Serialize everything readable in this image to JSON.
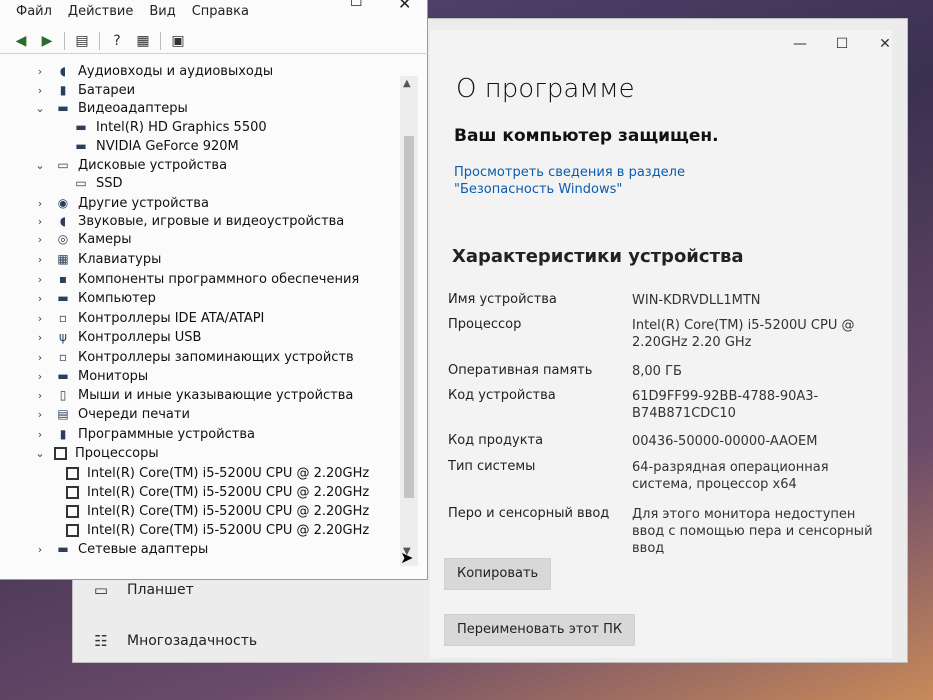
{
  "device_manager": {
    "menu": [
      "Файл",
      "Действие",
      "Вид",
      "Справка"
    ],
    "tree": [
      {
        "label": "Аудиовходы и аудиовыходы",
        "icon": "speaker-icon",
        "level": 0,
        "expanded": false
      },
      {
        "label": "Батареи",
        "icon": "battery-icon",
        "level": 0,
        "expanded": false
      },
      {
        "label": "Видеоадаптеры",
        "icon": "monitor-icon",
        "level": 0,
        "expanded": true
      },
      {
        "label": "Intel(R) HD Graphics 5500",
        "icon": "monitor-icon",
        "level": 1
      },
      {
        "label": "NVIDIA GeForce 920M",
        "icon": "monitor-icon",
        "level": 1
      },
      {
        "label": "Дисковые устройства",
        "icon": "disk-icon",
        "level": 0,
        "expanded": true
      },
      {
        "label": "SSD",
        "icon": "disk-icon",
        "level": 1
      },
      {
        "label": "Другие устройства",
        "icon": "unknown-device-icon",
        "level": 0,
        "expanded": false
      },
      {
        "label": "Звуковые, игровые и видеоустройства",
        "icon": "speaker-icon",
        "level": 0,
        "expanded": false
      },
      {
        "label": "Камеры",
        "icon": "camera-icon",
        "level": 0,
        "expanded": false
      },
      {
        "label": "Клавиатуры",
        "icon": "keyboard-icon",
        "level": 0,
        "expanded": false
      },
      {
        "label": "Компоненты программного обеспечения",
        "icon": "component-icon",
        "level": 0,
        "expanded": false
      },
      {
        "label": "Компьютер",
        "icon": "computer-icon",
        "level": 0,
        "expanded": false
      },
      {
        "label": "Контроллеры IDE ATA/ATAPI",
        "icon": "controller-icon",
        "level": 0,
        "expanded": false
      },
      {
        "label": "Контроллеры USB",
        "icon": "usb-icon",
        "level": 0,
        "expanded": false
      },
      {
        "label": "Контроллеры запоминающих устройств",
        "icon": "storage-controller-icon",
        "level": 0,
        "expanded": false
      },
      {
        "label": "Мониторы",
        "icon": "monitor-icon",
        "level": 0,
        "expanded": false
      },
      {
        "label": "Мыши и иные указывающие устройства",
        "icon": "mouse-icon",
        "level": 0,
        "expanded": false
      },
      {
        "label": "Очереди печати",
        "icon": "printer-icon",
        "level": 0,
        "expanded": false
      },
      {
        "label": "Программные устройства",
        "icon": "software-device-icon",
        "level": 0,
        "expanded": false
      },
      {
        "label": "Процессоры",
        "icon": "cpu-icon",
        "level": 0,
        "expanded": true
      },
      {
        "label": "Intel(R) Core(TM) i5-5200U CPU @ 2.20GHz",
        "icon": "cpu-icon",
        "level": 1
      },
      {
        "label": "Intel(R) Core(TM) i5-5200U CPU @ 2.20GHz",
        "icon": "cpu-icon",
        "level": 1
      },
      {
        "label": "Intel(R) Core(TM) i5-5200U CPU @ 2.20GHz",
        "icon": "cpu-icon",
        "level": 1
      },
      {
        "label": "Intel(R) Core(TM) i5-5200U CPU @ 2.20GHz",
        "icon": "cpu-icon",
        "level": 1
      },
      {
        "label": "Сетевые адаптеры",
        "icon": "network-icon",
        "level": 0,
        "expanded": false
      }
    ]
  },
  "settings": {
    "nav": [
      {
        "label": "Планшет",
        "icon": "tablet-icon"
      },
      {
        "label": "Многозадачность",
        "icon": "multitasking-icon"
      }
    ],
    "about": {
      "title": "О программе",
      "protected": "Ваш компьютер защищен.",
      "security_link": "Просмотреть сведения в разделе \"Безопасность Windows\"",
      "specs_title": "Характеристики устройства",
      "specs": [
        {
          "label": "Имя устройства",
          "value": "WIN-KDRVDLL1MTN"
        },
        {
          "label": "Процессор",
          "value": "Intel(R) Core(TM) i5-5200U CPU @ 2.20GHz   2.20 GHz"
        },
        {
          "label": "Оперативная память",
          "value": "8,00 ГБ"
        },
        {
          "label": "Код устройства",
          "value": "61D9FF99-92BB-4788-90A3-B74B871CDC10"
        },
        {
          "label": "Код продукта",
          "value": "00436-50000-00000-AAOEM"
        },
        {
          "label": "Тип системы",
          "value": "64-разрядная операционная система, процессор x64"
        },
        {
          "label": "Перо и сенсорный ввод",
          "value": "Для этого монитора недоступен ввод с помощью пера и сенсорный ввод"
        }
      ],
      "copy_button": "Копировать",
      "rename_button": "Переименовать этот ПК"
    }
  },
  "colors": {
    "link": "#0b5cad",
    "window_bg": "#f3f3f3"
  }
}
